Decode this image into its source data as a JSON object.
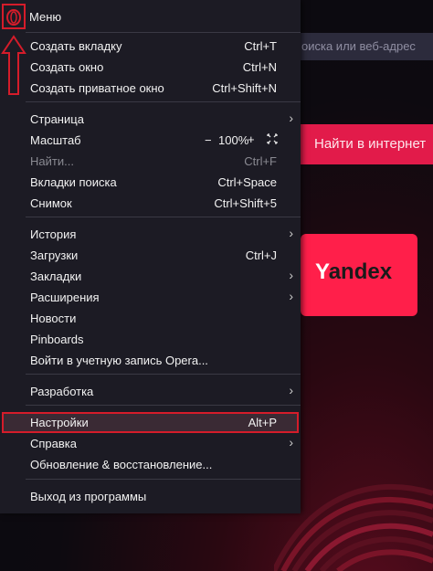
{
  "background": {
    "address_placeholder": "оиска или веб-адрес",
    "search_button": "Найти в интернет",
    "tile": {
      "first_letter": "Y",
      "rest": "andex"
    }
  },
  "menu": {
    "title": "Меню",
    "groups": [
      {
        "items": [
          {
            "label": "Создать вкладку",
            "shortcut": "Ctrl+T"
          },
          {
            "label": "Создать окно",
            "shortcut": "Ctrl+N"
          },
          {
            "label": "Создать приватное окно",
            "shortcut": "Ctrl+Shift+N"
          }
        ]
      },
      {
        "items": [
          {
            "label": "Страница",
            "submenu": true
          },
          {
            "label": "Масштаб",
            "zoom_minus": "−",
            "zoom_value": "100%",
            "zoom_plus": "+"
          },
          {
            "label": "Найти...",
            "shortcut": "Ctrl+F",
            "disabled": true
          },
          {
            "label": "Вкладки поиска",
            "shortcut": "Ctrl+Space"
          },
          {
            "label": "Снимок",
            "shortcut": "Ctrl+Shift+5"
          }
        ]
      },
      {
        "items": [
          {
            "label": "История",
            "submenu": true
          },
          {
            "label": "Загрузки",
            "shortcut": "Ctrl+J"
          },
          {
            "label": "Закладки",
            "submenu": true
          },
          {
            "label": "Расширения",
            "submenu": true
          },
          {
            "label": "Новости"
          },
          {
            "label": "Pinboards"
          },
          {
            "label": "Войти в учетную запись Opera..."
          }
        ]
      },
      {
        "items": [
          {
            "label": "Разработка",
            "submenu": true
          }
        ]
      },
      {
        "items": [
          {
            "label": "Настройки",
            "shortcut": "Alt+P",
            "highlighted": true
          },
          {
            "label": "Справка",
            "submenu": true
          },
          {
            "label": "Обновление & восстановление..."
          }
        ]
      },
      {
        "items": [
          {
            "label": "Выход из программы"
          }
        ]
      }
    ]
  },
  "colors": {
    "accent": "#d51c2a",
    "brand_red": "#e21b4a",
    "menu_bg": "#1c1b24"
  }
}
